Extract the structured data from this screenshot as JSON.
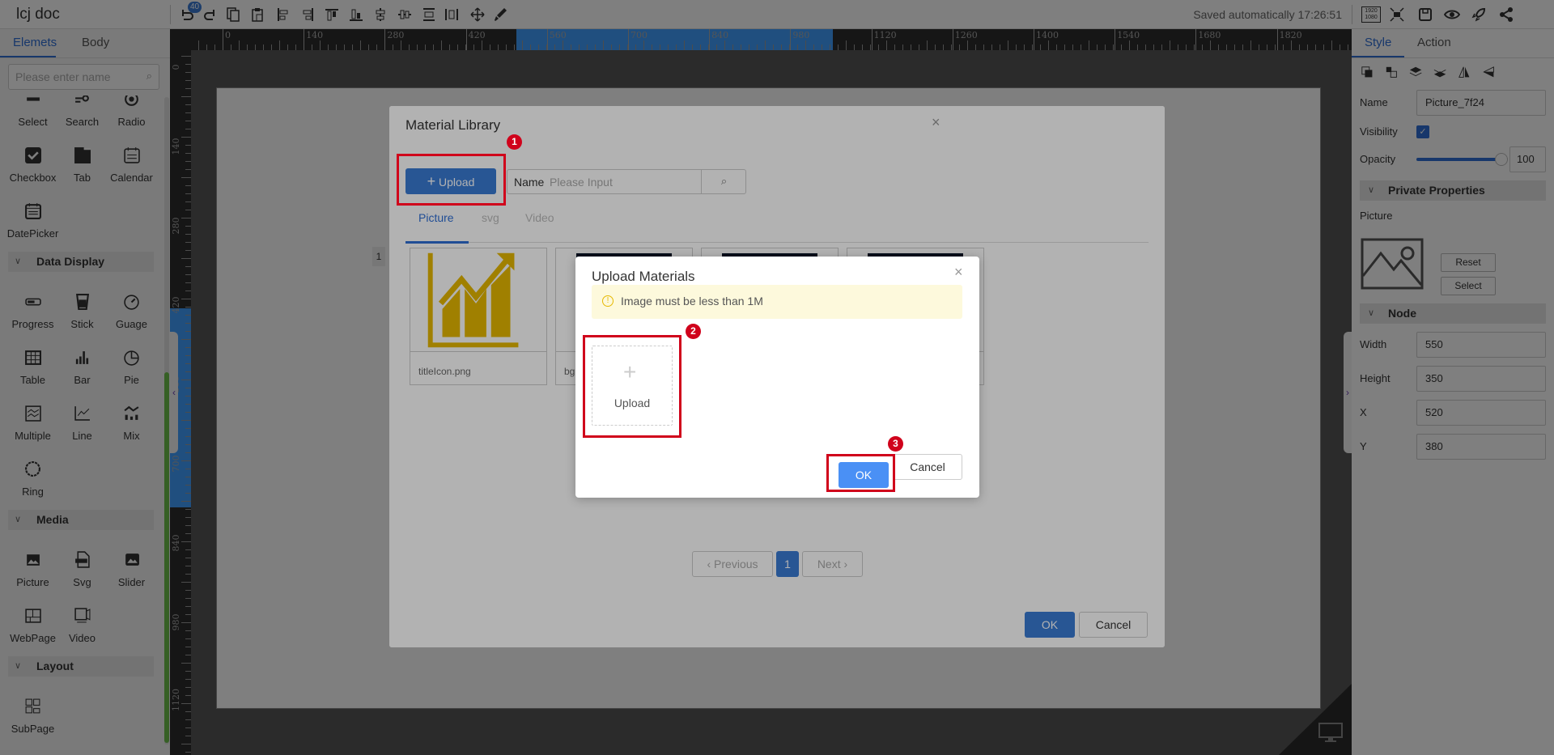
{
  "app": {
    "title": "lcj doc",
    "undo_count_badge": "40",
    "save_status": "Saved automatically 17:26:51",
    "resolution_icon_text": [
      "1920",
      "1080"
    ]
  },
  "toolbar": {
    "left_icons": [
      "undo-icon",
      "redo-icon",
      "copy-icon",
      "paste-icon",
      "align-left-icon",
      "align-right-icon",
      "align-top-icon",
      "align-bottom-icon",
      "align-horizontal-center-icon",
      "align-vertical-center-icon",
      "distribute-vertical-icon",
      "distribute-horizontal-icon",
      "move-icon",
      "brush-icon"
    ],
    "right_icons": [
      "resolution-icon",
      "fit-screen-icon",
      "save-icon",
      "preview-eye-icon",
      "publish-rocket-icon",
      "share-icon"
    ]
  },
  "left_panel": {
    "tabs": [
      "Elemets",
      "Body"
    ],
    "active_tab": "Elemets",
    "search_placeholder": "Please enter name",
    "groups": [
      {
        "title": "",
        "items": [
          {
            "label": "Select",
            "icon": "select-icon"
          },
          {
            "label": "Search",
            "icon": "search-icon"
          },
          {
            "label": "Radio",
            "icon": "radio-icon"
          },
          {
            "label": "Checkbox",
            "icon": "checkbox-icon"
          },
          {
            "label": "Tab",
            "icon": "tab-icon"
          },
          {
            "label": "Calendar",
            "icon": "calendar-icon"
          },
          {
            "label": "DatePicker",
            "icon": "datepicker-icon"
          }
        ]
      },
      {
        "title": "Data Display",
        "items": [
          {
            "label": "Progress",
            "icon": "progress-icon"
          },
          {
            "label": "Stick",
            "icon": "stick-icon"
          },
          {
            "label": "Guage",
            "icon": "gauge-icon"
          },
          {
            "label": "Table",
            "icon": "table-icon"
          },
          {
            "label": "Bar",
            "icon": "bar-chart-icon"
          },
          {
            "label": "Pie",
            "icon": "pie-chart-icon"
          },
          {
            "label": "Multiple",
            "icon": "multiple-chart-icon"
          },
          {
            "label": "Line",
            "icon": "line-chart-icon"
          },
          {
            "label": "Mix",
            "icon": "mix-chart-icon"
          },
          {
            "label": "Ring",
            "icon": "ring-icon"
          }
        ]
      },
      {
        "title": "Media",
        "items": [
          {
            "label": "Picture",
            "icon": "picture-icon"
          },
          {
            "label": "Svg",
            "icon": "svg-icon"
          },
          {
            "label": "Slider",
            "icon": "slider-icon"
          },
          {
            "label": "WebPage",
            "icon": "webpage-icon"
          },
          {
            "label": "Video",
            "icon": "video-icon"
          }
        ]
      },
      {
        "title": "Layout",
        "items": [
          {
            "label": "SubPage",
            "icon": "subpage-icon"
          }
        ]
      }
    ]
  },
  "canvas": {
    "h_ruler_labels": [
      "0",
      "140",
      "280",
      "420",
      "560",
      "700",
      "840",
      "980",
      "1120",
      "1260",
      "1400",
      "1540",
      "1680",
      "1820"
    ],
    "v_ruler_labels": [
      "0",
      "140",
      "280",
      "420",
      "560",
      "700",
      "840",
      "980",
      "1120"
    ],
    "layer_tag": "1",
    "highlight_color": "#409eff"
  },
  "right_panel": {
    "tabs": [
      "Style",
      "Action"
    ],
    "active_tab": "Style",
    "layer_icons": [
      "bring-to-front-icon",
      "send-to-back-icon",
      "move-up-layer-icon",
      "move-down-layer-icon",
      "flip-horizontal-icon",
      "flip-vertical-icon"
    ],
    "name_label": "Name",
    "name_value": "Picture_7f24",
    "visibility_label": "Visibility",
    "visibility_checked": true,
    "opacity_label": "Opacity",
    "opacity_value": "100",
    "opacity_fraction": 1.0,
    "private_header": "Private Properties",
    "picture_label": "Picture",
    "reset_label": "Reset",
    "select_label": "Select",
    "node_header": "Node",
    "node_fields": [
      {
        "label": "Width",
        "value": "550"
      },
      {
        "label": "Height",
        "value": "350"
      },
      {
        "label": "X",
        "value": "520"
      },
      {
        "label": "Y",
        "value": "380"
      }
    ]
  },
  "material_library": {
    "title": "Material Library",
    "upload_label": "Upload",
    "name_label": "Name",
    "name_placeholder": "Please Input",
    "tabs": [
      "Picture",
      "svg",
      "Video"
    ],
    "active_tab": "Picture",
    "cards": [
      {
        "label": "titleIcon.png",
        "kind": "chart-icon-image"
      },
      {
        "label": "bg",
        "kind": "dark-image"
      },
      {
        "label": "",
        "kind": "dark-image"
      },
      {
        "label": "",
        "kind": "dark-image"
      }
    ],
    "pagination": {
      "previous": "Previous",
      "current": "1",
      "next": "Next"
    },
    "ok_label": "OK",
    "cancel_label": "Cancel",
    "step_badge": "1"
  },
  "upload_dialog": {
    "title": "Upload Materials",
    "alert": "Image must be less than 1M",
    "upload_label": "Upload",
    "ok_label": "OK",
    "cancel_label": "Cancel",
    "step_badges": [
      "2",
      "3"
    ]
  },
  "colors": {
    "primary": "#3a7bd5",
    "annotation_red": "#d0021b",
    "alert_bg": "#fdf9dc",
    "accent_green": "#6cc04a"
  }
}
